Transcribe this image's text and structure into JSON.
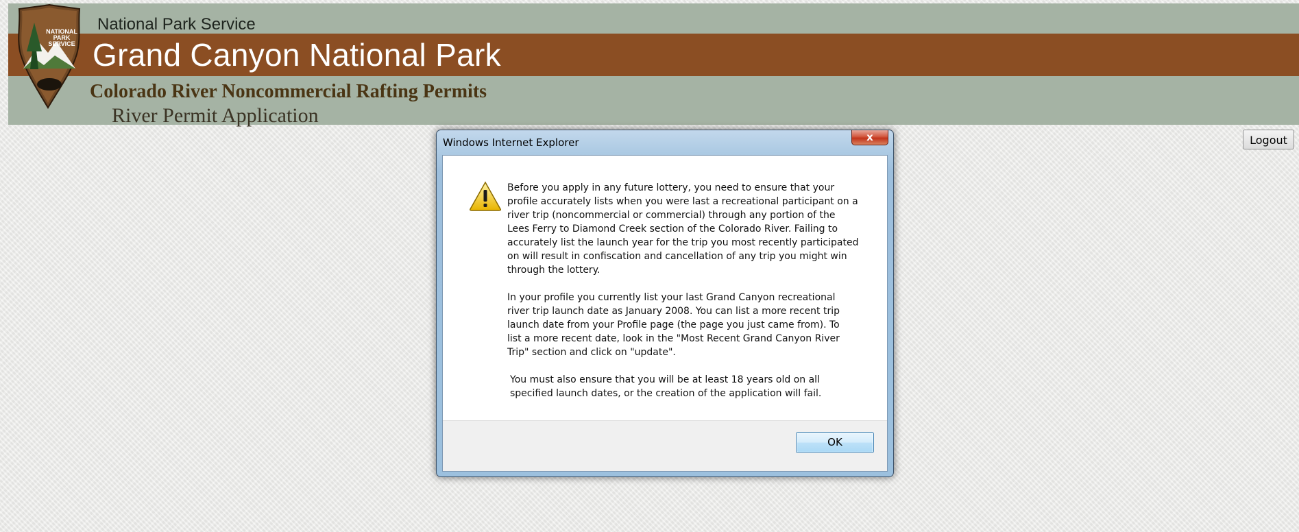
{
  "header": {
    "agency": "National Park Service",
    "logo_text": [
      "NATIONAL",
      "PARK",
      "SERVICE"
    ],
    "park_name": "Grand Canyon National Park",
    "program": "Colorado River Noncommercial Rafting Permits",
    "page_title": "River Permit Application"
  },
  "actions": {
    "logout_label": "Logout"
  },
  "dialog": {
    "title": "Windows Internet Explorer",
    "close_label": "x",
    "paragraphs": [
      "Before you apply in any future lottery, you need to ensure that your\nprofile accurately lists when you were last a recreational participant on a\nriver trip (noncommercial or commercial) through any portion of the\nLees Ferry to Diamond Creek section of the Colorado River. Failing to\naccurately list the launch year for the trip you most recently participated\non will result in confiscation and cancellation of any trip you might win\nthrough the lottery.",
      "In your profile you currently list your last Grand Canyon recreational\nriver trip launch date as January 2008. You can list a more recent trip\nlaunch date from your Profile page (the page you just came from). To\nlist a more recent date, look in the \"Most Recent Grand Canyon River\nTrip\" section and click on \"update\".",
      "You must also ensure that you will be at least 18 years old on all\nspecified launch dates, or the creation of the application will fail."
    ],
    "ok_label": "OK"
  },
  "colors": {
    "banner_green": "#a5b3a4",
    "banner_brown": "#8b4e23",
    "dialog_frame": "#9cc0de"
  }
}
